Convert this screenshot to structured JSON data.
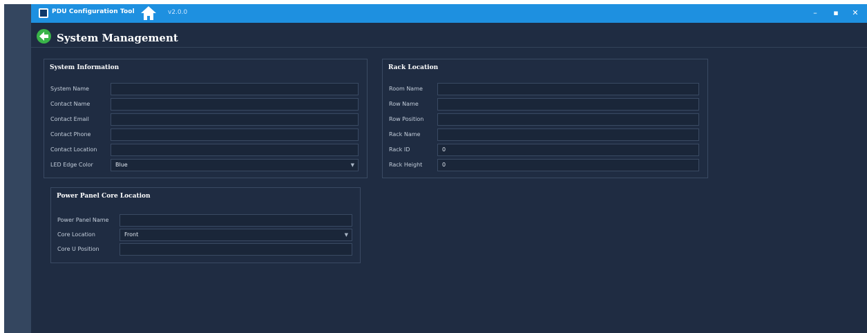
{
  "titlebar": {
    "app_title": "PDU Configuration Tool",
    "version": "v2.0.0",
    "controls": {
      "minimize": "–",
      "maximize": "▪",
      "close": "✕"
    }
  },
  "header": {
    "title": "System Management"
  },
  "system_information": {
    "title": "System Information",
    "fields": [
      {
        "label": "System Name",
        "value": ""
      },
      {
        "label": "Contact Name",
        "value": ""
      },
      {
        "label": "Contact Email",
        "value": ""
      },
      {
        "label": "Contact Phone",
        "value": ""
      },
      {
        "label": "Contact Location",
        "value": ""
      }
    ],
    "led_edge_color": {
      "label": "LED Edge Color",
      "value": "Blue"
    }
  },
  "rack_location": {
    "title": "Rack Location",
    "fields": [
      {
        "label": "Room Name",
        "value": ""
      },
      {
        "label": "Row Name",
        "value": ""
      },
      {
        "label": "Row Position",
        "value": ""
      },
      {
        "label": "Rack Name",
        "value": ""
      },
      {
        "label": "Rack ID",
        "value": "0"
      },
      {
        "label": "Rack Height",
        "value": "0"
      }
    ]
  },
  "power_panel": {
    "title": "Power Panel  Core Location",
    "power_panel_name": {
      "label": "Power Panel Name",
      "value": ""
    },
    "core_location": {
      "label": "Core Location",
      "value": "Front"
    },
    "core_u_position": {
      "label": "Core U Position",
      "value": ""
    }
  },
  "colors": {
    "background": "#1f2c42",
    "titlebar": "#1e90e0",
    "left_rail": "#34465f",
    "back_button": "#39b449"
  },
  "icons": {
    "logo": "pdu-logo-icon",
    "home": "home-icon",
    "back": "back-arrow-icon",
    "dropdown": "chevron-down-icon"
  }
}
